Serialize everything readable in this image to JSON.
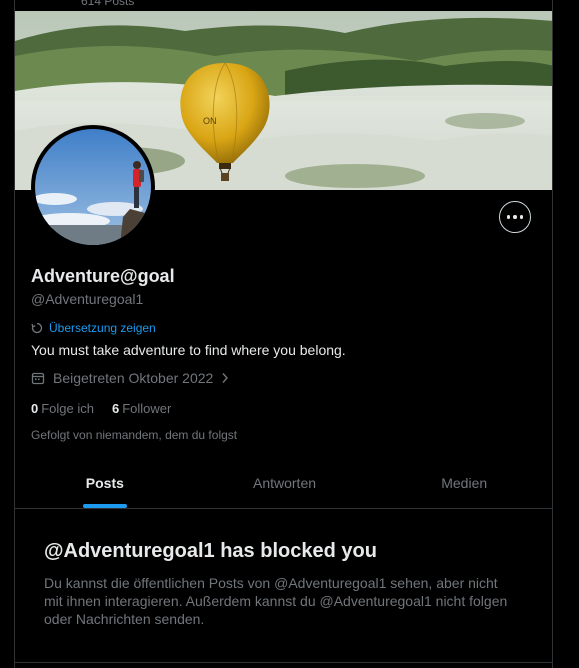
{
  "header": {
    "posts_count_label": "614 Posts"
  },
  "profile": {
    "display_name": "Adventure@goal",
    "handle": "@Adventuregoal1",
    "translate_label": "Übersetzung zeigen",
    "bio": "You must take adventure to find where you belong.",
    "joined": "Beigetreten Oktober 2022",
    "following_count": "0",
    "following_label": "Folge ich",
    "followers_count": "6",
    "followers_label": "Follower",
    "followed_by": "Gefolgt von niemandem, dem du folgst",
    "banner_text": "ON"
  },
  "tabs": [
    {
      "label": "Posts",
      "active": true
    },
    {
      "label": "Antworten",
      "active": false
    },
    {
      "label": "Medien",
      "active": false
    }
  ],
  "blocked": {
    "title": "@Adventuregoal1 has blocked you",
    "message": "Du kannst die öffentlichen Posts von @Adventuregoal1 sehen, aber nicht mit ihnen interagieren. Außerdem kannst du @Adventuregoal1 nicht folgen oder Nachrichten senden."
  },
  "colors": {
    "accent": "#1d9bf0",
    "background": "#000000",
    "muted": "#71767b",
    "text": "#e7e9ea"
  },
  "icons": {
    "more": "more-horizontal-icon",
    "translate": "translate-icon",
    "calendar": "calendar-icon",
    "chevron": "chevron-right-icon"
  }
}
